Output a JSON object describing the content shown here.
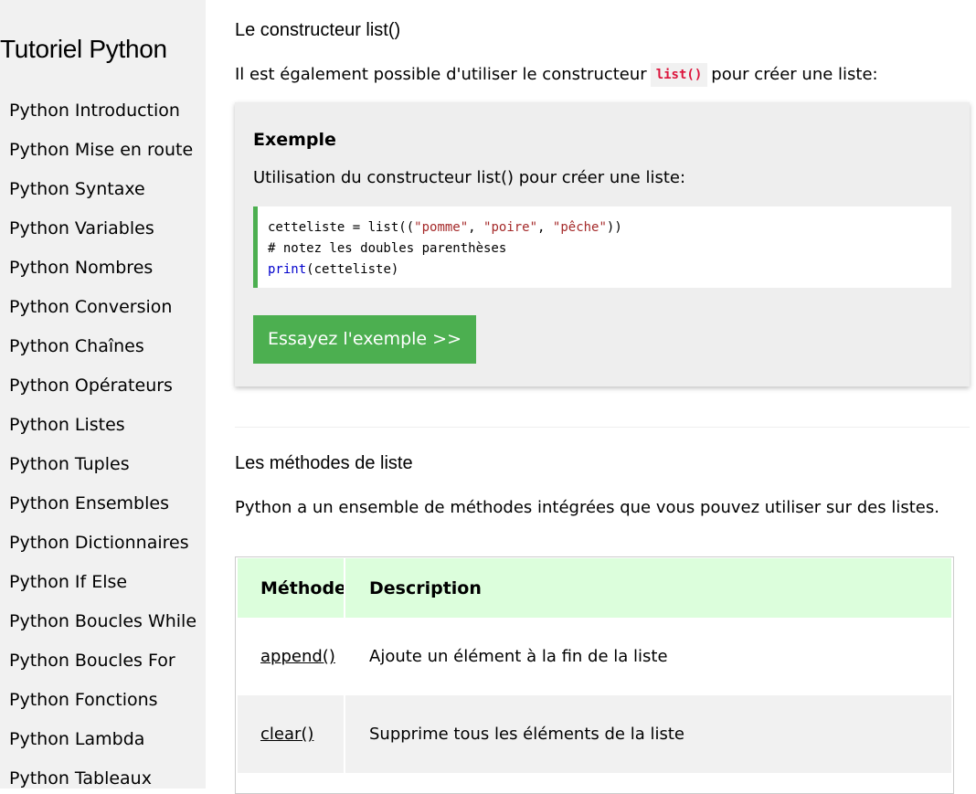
{
  "sidebar": {
    "title": "Tutoriel Python",
    "items": [
      {
        "label": "Python Introduction"
      },
      {
        "label": "Python Mise en route"
      },
      {
        "label": "Python Syntaxe"
      },
      {
        "label": "Python Variables"
      },
      {
        "label": "Python Nombres"
      },
      {
        "label": "Python Conversion"
      },
      {
        "label": "Python Chaînes"
      },
      {
        "label": "Python Opérateurs"
      },
      {
        "label": "Python Listes"
      },
      {
        "label": "Python Tuples"
      },
      {
        "label": "Python Ensembles"
      },
      {
        "label": "Python Dictionnaires"
      },
      {
        "label": "Python If Else"
      },
      {
        "label": "Python Boucles While"
      },
      {
        "label": "Python Boucles For"
      },
      {
        "label": "Python Fonctions"
      },
      {
        "label": "Python Lambda"
      },
      {
        "label": "Python Tableaux"
      }
    ]
  },
  "main": {
    "section1": {
      "heading": "Le constructeur list()",
      "text_before": "Il est également possible d'utiliser le constructeur",
      "inline_code": "list()",
      "text_after": "pour créer une liste:"
    },
    "example": {
      "heading": "Exemple",
      "description": "Utilisation du constructeur list() pour créer une liste:",
      "code": {
        "line1_a": "cetteliste = list((",
        "str1": "\"pomme\"",
        "sep1": ", ",
        "str2": "\"poire\"",
        "sep2": ", ",
        "str3": "\"pêche\"",
        "line1_b": "))",
        "line2": "# notez les doubles parenthèses",
        "kw_print": "print",
        "line3_rest": "(cetteliste)"
      },
      "button_label": "Essayez l'exemple >>"
    },
    "section2": {
      "heading": "Les méthodes de liste",
      "text": "Python a un ensemble de méthodes intégrées que vous pouvez utiliser sur des listes."
    },
    "table": {
      "headers": [
        "Méthode",
        "Description"
      ],
      "rows": [
        {
          "method": "append()",
          "description": "Ajoute un élément à la fin de la liste"
        },
        {
          "method": "clear()",
          "description": "Supprime tous les éléments de la liste"
        }
      ]
    }
  },
  "colors": {
    "accent_green": "#4caf50",
    "sidebar_bg": "#f1f1f1",
    "table_header_bg": "#dcfedc",
    "inline_code_color": "#dc143c"
  }
}
